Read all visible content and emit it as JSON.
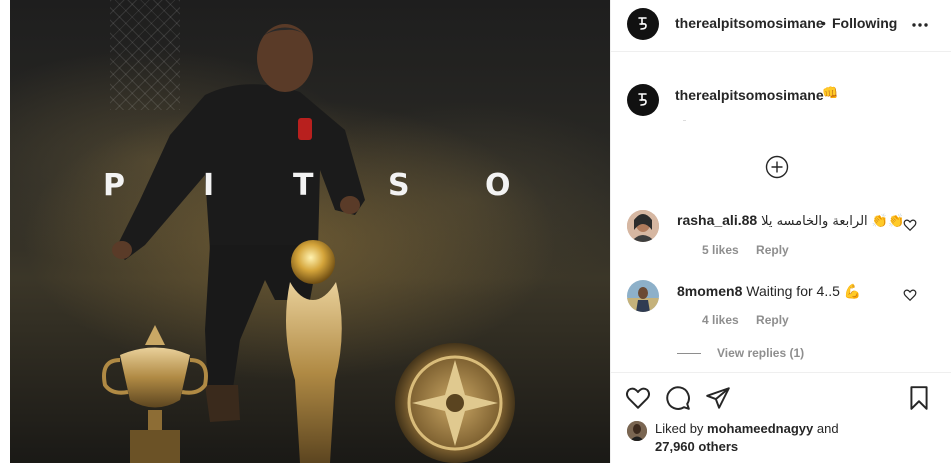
{
  "post": {
    "username": "therealpitsomosimane",
    "dot": "•",
    "follow_status": "Following",
    "image_title_letters": [
      "P",
      "I",
      "T",
      "S",
      "O"
    ]
  },
  "caption": {
    "username": "therealpitsomosimane",
    "emoji": "👊"
  },
  "comments": [
    {
      "username": "rasha_ali.88",
      "text": "الرابعة والخامسه يلا 👏👏",
      "likes": "5 likes",
      "reply": "Reply",
      "avatar_color": "#c9a78e"
    },
    {
      "username": "8momen8",
      "text": "Waiting for 4..5 💪",
      "likes": "4 likes",
      "reply": "Reply",
      "avatar_color": "#b9b08a",
      "view_replies": "View replies (1)"
    }
  ],
  "likes": {
    "prefix": "Liked by",
    "user": "mohameednagyy",
    "and": "and",
    "others": "27,960 others"
  },
  "icons": {
    "more": "more-options-icon",
    "load_more": "plus-circle-icon",
    "heart": "heart-icon",
    "comment": "comment-icon",
    "share": "share-icon",
    "save": "bookmark-icon"
  }
}
